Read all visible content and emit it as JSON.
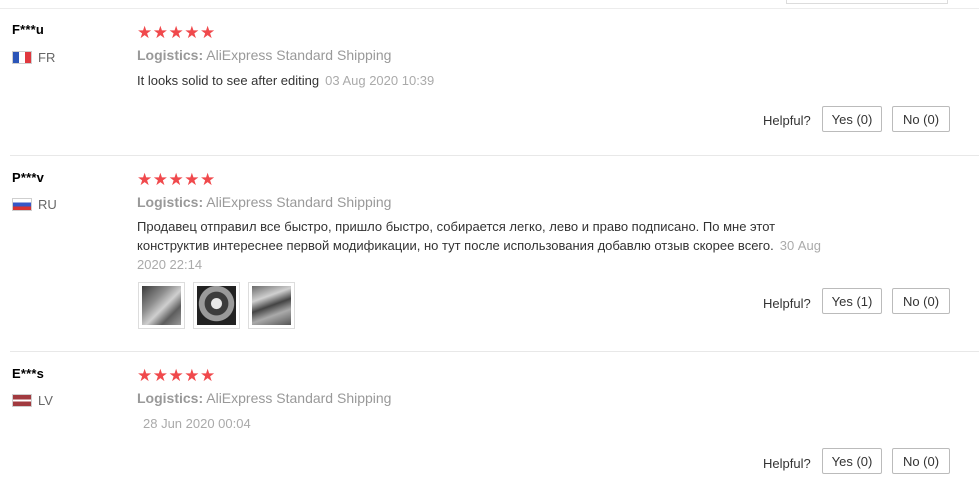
{
  "reviews": [
    {
      "user": "F***u",
      "flag": "fr-flag-icon",
      "country": "FR",
      "stars": "★★★★★",
      "rating": 5,
      "logistics_label": "Logistics:",
      "logistics_value": "AliExpress Standard Shipping",
      "comment": "It looks solid to see after editing",
      "date": "03 Aug 2020 10:39",
      "helpful_label": "Helpful?",
      "yes_label": "Yes (0)",
      "no_label": "No (0)"
    },
    {
      "user": "P***v",
      "flag": "ru-flag-icon",
      "country": "RU",
      "stars": "★★★★★",
      "rating": 5,
      "logistics_label": "Logistics:",
      "logistics_value": "AliExpress Standard Shipping",
      "comment": "Продавец отправил все быстро, пришло быстро, собирается легко, лево и право подписано. По мне этот конструктив интереснее первой модификации, но тут после использования добавлю отзыв скорее всего.",
      "date": "30 Aug 2020 22:14",
      "photos": [
        "review-photo",
        "review-photo",
        "review-photo"
      ],
      "helpful_label": "Helpful?",
      "yes_label": "Yes (1)",
      "no_label": "No (0)"
    },
    {
      "user": "E***s",
      "flag": "lv-flag-icon",
      "country": "LV",
      "stars": "★★★★★",
      "rating": 5,
      "logistics_label": "Logistics:",
      "logistics_value": "AliExpress Standard Shipping",
      "comment": "",
      "date": "28 Jun 2020 00:04",
      "helpful_label": "Helpful?",
      "yes_label": "Yes (0)",
      "no_label": "No (0)"
    }
  ],
  "colors": {
    "star": "#f0494c",
    "muted": "#999999",
    "border": "#bbbbbb"
  }
}
